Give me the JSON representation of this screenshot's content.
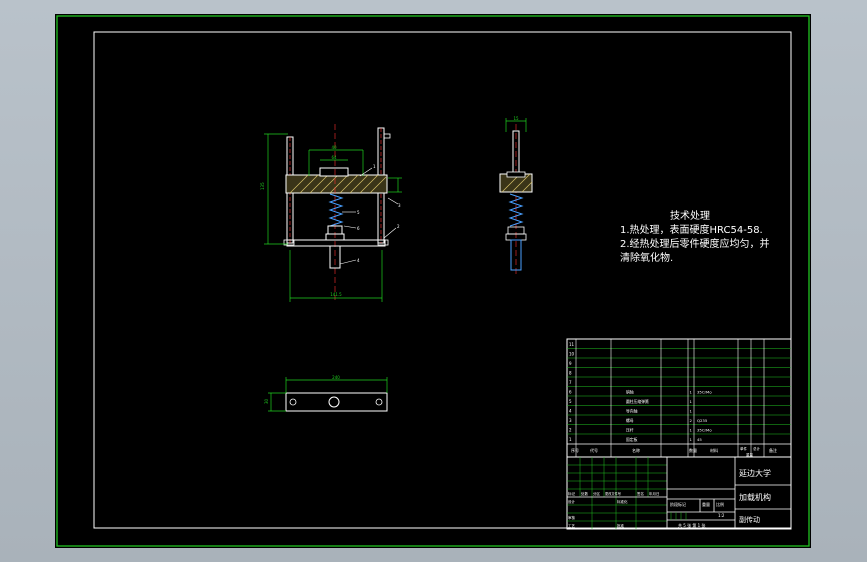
{
  "colors": {
    "background": "#000000",
    "frame": "#21c321",
    "line": "#ffffff",
    "dimension": "#1fd11f",
    "hatch": "#d6c06a",
    "spring": "#4aa0ff",
    "accent_red": "#ff3030",
    "text": "#ffffff"
  },
  "tech_notes": {
    "title": "技术处理",
    "lines": [
      "1.热处理，表面硬度HRC54-58.",
      "2.经热处理后零件硬度应均匀，并",
      "清除氧化物."
    ]
  },
  "front_view": {
    "dims": {
      "top_width": "40",
      "inner_width": "64",
      "height": "135",
      "bottom_width": "141.5"
    },
    "balloons": [
      "5",
      "6",
      "4",
      "3",
      "2",
      "1"
    ]
  },
  "side_view": {
    "dims": {
      "top": "15"
    }
  },
  "bottom_view": {
    "dims": {
      "length": "240",
      "height": "30"
    }
  },
  "parts_list": {
    "numbers": [
      "11",
      "10",
      "9",
      "8",
      "7",
      "6",
      "5",
      "4",
      "3",
      "2",
      "1"
    ],
    "rows": [
      {
        "no": "6",
        "name": "销轴",
        "qty": "1",
        "material": "35CrMo"
      },
      {
        "no": "5",
        "name": "圆柱压缩弹簧",
        "qty": "1",
        "material": ""
      },
      {
        "no": "4",
        "name": "导向轴",
        "qty": "1",
        "material": ""
      },
      {
        "no": "3",
        "name": "螺母",
        "qty": "2",
        "material": "Q235"
      },
      {
        "no": "2",
        "name": "压杆",
        "qty": "1",
        "material": "35CrMo"
      },
      {
        "no": "1",
        "name": "固定板",
        "qty": "1",
        "material": "45"
      }
    ],
    "header": {
      "no": "序号",
      "code": "代号",
      "name": "名称",
      "qty": "数量",
      "material": "材料",
      "unit_weight": "单件",
      "total_weight": "总计",
      "weight": "重量",
      "remarks": "备注"
    }
  },
  "title_block": {
    "school": "延边大学",
    "drawing_title": "加载机构",
    "subtitle": "副传动",
    "left_labels": [
      "标记",
      "处数",
      "分区",
      "更改文件号",
      "签名",
      "年月日"
    ],
    "design_label": "设计",
    "standardize_label": "标准化",
    "review_label": "审核",
    "process_label": "工艺",
    "approve_label": "批准",
    "stage_label": "阶段标记",
    "weight_label": "重量",
    "scale_label": "比例",
    "scale_value": "1:2",
    "sheets": "共 5 张  第 1 张"
  }
}
